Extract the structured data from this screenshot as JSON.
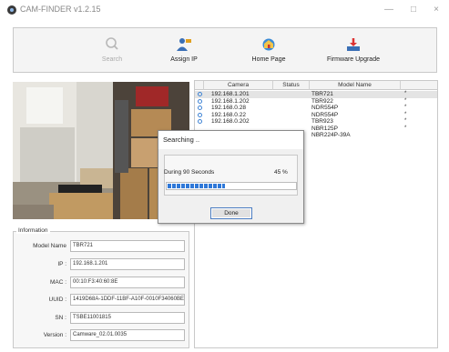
{
  "window": {
    "title": "CAM-FINDER v1.2.15",
    "min_glyph": "—",
    "max_glyph": "□",
    "close_glyph": "×"
  },
  "toolbar": {
    "search_label": "Search",
    "assign_ip_label": "Assign IP",
    "home_page_label": "Home Page",
    "firmware_label": "Firmware Upgrade"
  },
  "list": {
    "columns": [
      "Camera",
      "Status",
      "Model Name"
    ],
    "rows": [
      {
        "ip": "192.168.1.201",
        "status": "",
        "model": "TBR721",
        "star": "*"
      },
      {
        "ip": "192.168.1.202",
        "status": "",
        "model": "TBR922",
        "star": "*"
      },
      {
        "ip": "192.168.0.28",
        "status": "",
        "model": "NDR554P",
        "star": "*"
      },
      {
        "ip": "192.168.0.22",
        "status": "",
        "model": "NDR554P",
        "star": "*"
      },
      {
        "ip": "192.168.0.202",
        "status": "",
        "model": "TBR923",
        "star": "*"
      },
      {
        "ip": "",
        "status": "",
        "model": "NBR125P",
        "star": "*"
      },
      {
        "ip": "",
        "status": "",
        "model": "NBR224P-39A",
        "star": ""
      }
    ]
  },
  "info": {
    "legend": "Information",
    "fields": [
      {
        "label": "Model Name",
        "value": "TBR721"
      },
      {
        "label": "IP :",
        "value": "192.168.1.201"
      },
      {
        "label": "MAC :",
        "value": "00:10:F3:40:60:8E"
      },
      {
        "label": "UUID :",
        "value": "1419D68A-1DDF-11BF-A10F-0010F34060BE"
      },
      {
        "label": "SN :",
        "value": "TSBE11001815"
      },
      {
        "label": "Version :",
        "value": "Camware_02.01.0035"
      }
    ]
  },
  "dialog": {
    "title": "Searching ..",
    "message": "During 90 Seconds",
    "percent_text": "45 %",
    "progress": 0.45,
    "done_label": "Done"
  },
  "colors": {
    "progress_blue": "#2f78d8",
    "focus_border": "#4a7cc1"
  }
}
